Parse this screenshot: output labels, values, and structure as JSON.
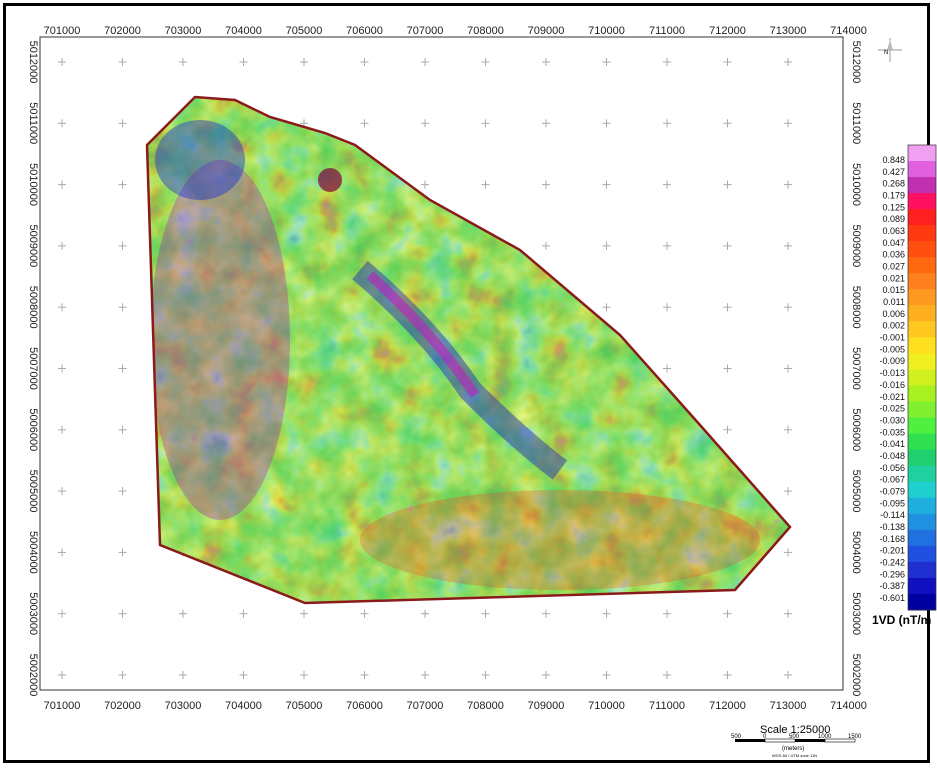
{
  "map": {
    "x_ticks": [
      "701000",
      "702000",
      "703000",
      "704000",
      "705000",
      "706000",
      "707000",
      "708000",
      "709000",
      "710000",
      "711000",
      "712000",
      "713000",
      "714000"
    ],
    "y_ticks": [
      "5012000",
      "5011000",
      "5010000",
      "5009000",
      "5008000",
      "5007000",
      "5006000",
      "5005000",
      "5004000",
      "5003000",
      "5002000"
    ],
    "survey_outline_color": "#8b1a1a"
  },
  "legend": {
    "values": [
      "0.848",
      "0.427",
      "0.268",
      "0.179",
      "0.125",
      "0.089",
      "0.063",
      "0.047",
      "0.036",
      "0.027",
      "0.021",
      "0.015",
      "0.011",
      "0.006",
      "0.002",
      "-0.001",
      "-0.005",
      "-0.009",
      "-0.013",
      "-0.016",
      "-0.021",
      "-0.025",
      "-0.030",
      "-0.035",
      "-0.041",
      "-0.048",
      "-0.056",
      "-0.067",
      "-0.079",
      "-0.095",
      "-0.114",
      "-0.138",
      "-0.168",
      "-0.201",
      "-0.242",
      "-0.296",
      "-0.387",
      "-0.601"
    ],
    "unit_label": "1VD (nT/m",
    "colors": [
      "#f0a0f0",
      "#e060e0",
      "#c030b0",
      "#ff1060",
      "#ff2020",
      "#ff3a10",
      "#ff5010",
      "#ff6a10",
      "#ff8020",
      "#ff9a20",
      "#ffb020",
      "#ffc820",
      "#ffe020",
      "#f0f020",
      "#d0f020",
      "#a8f020",
      "#80f030",
      "#50f040",
      "#30e050",
      "#20d070",
      "#20d0a0",
      "#20d0d0",
      "#20b0e0",
      "#2090e0",
      "#2070e0",
      "#2050e0",
      "#2030d0",
      "#1010c0",
      "#0000a0"
    ]
  },
  "scale_bar": {
    "title": "Scale 1:25000",
    "tick_labels": [
      "500",
      "0",
      "500",
      "1000",
      "1500"
    ],
    "units": "(meters)",
    "projection_note": "WGS 84 / UTM zone 11N"
  },
  "north_arrow": {
    "label": "N"
  }
}
